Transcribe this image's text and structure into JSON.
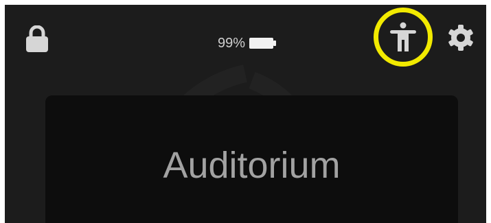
{
  "status_bar": {
    "lock_icon": "lock-icon",
    "battery_percent": "99%",
    "battery_icon": "battery-icon",
    "accessibility_icon": "accessibility-icon",
    "accessibility_highlight_color": "#f2ea00",
    "settings_icon": "gear-icon"
  },
  "room": {
    "name": "Auditorium"
  },
  "colors": {
    "background": "#1c1c1c",
    "card": "#0d0d0d",
    "icon": "#d6d6d6",
    "title": "#a2a2a2"
  }
}
